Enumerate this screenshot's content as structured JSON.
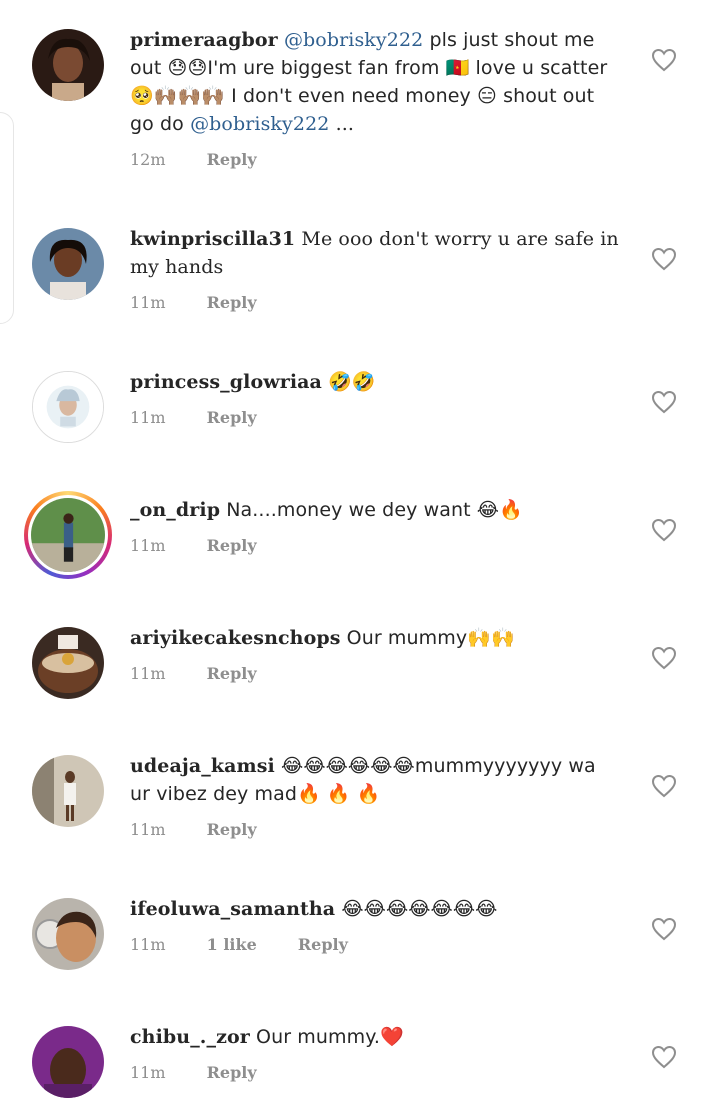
{
  "comments": [
    {
      "username": "primeraagbor",
      "mention": "@bobrisky222",
      "text_a": " pls just shout me out 😓😓I'm ure biggest fan from ",
      "text_b": " love u scatter 🥺🙌🏽🙌🏽🙌🏽 I don't even need money 😑 shout out go do ",
      "mention2": "@bobrisky222",
      "ellipsis": " ...",
      "time": "12m",
      "reply": "Reply"
    },
    {
      "username": "kwinpriscilla31",
      "text": " Me ooo don't worry u are safe in my hands",
      "time": "11m",
      "reply": "Reply"
    },
    {
      "username": "princess_glowriaa",
      "text": " 🤣🤣",
      "time": "11m",
      "reply": "Reply"
    },
    {
      "username": "_on_drip",
      "text": " Na....money we dey want 😂🔥",
      "time": "11m",
      "reply": "Reply"
    },
    {
      "username": "ariyikecakesnchops",
      "text": " Our mummy🙌🙌",
      "time": "11m",
      "reply": "Reply"
    },
    {
      "username": "udeaja_kamsi",
      "text": " 😂😂😂😂😂😂mummyyyyyyy wa ur vibez dey mad🔥 🔥 🔥",
      "time": "11m",
      "reply": "Reply"
    },
    {
      "username": "ifeoluwa_samantha",
      "text": " 😂😂😂😂😂😂😂",
      "time": "11m",
      "likes": "1 like",
      "reply": "Reply"
    },
    {
      "username": "chibu_._zor",
      "text": " Our mummy.❤️",
      "time": "11m",
      "reply": "Reply"
    }
  ],
  "colors": {
    "mention": "#2f5f8f",
    "meta": "#8e8e8e",
    "text": "#262626"
  }
}
